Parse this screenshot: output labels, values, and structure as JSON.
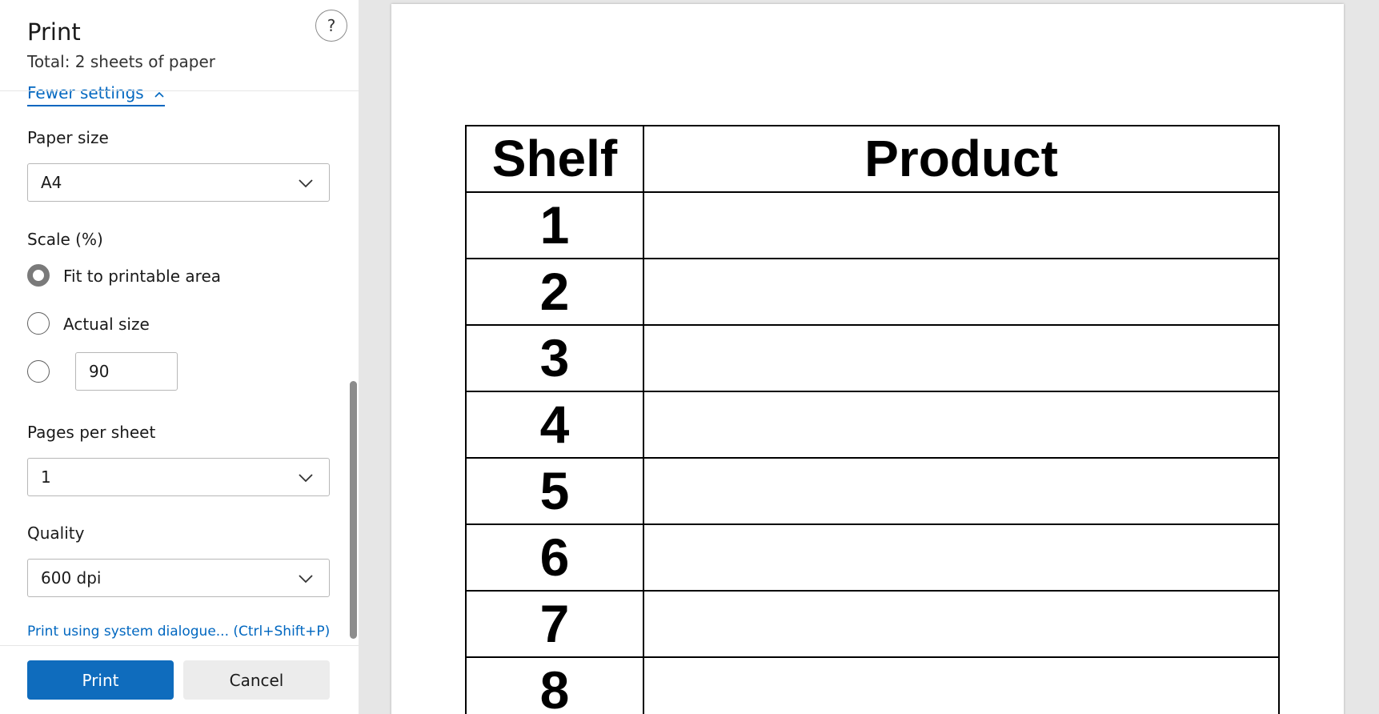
{
  "dialog": {
    "title": "Print",
    "subtitle": "Total: 2 sheets of paper",
    "help_label": "?",
    "fewer_settings_label": "Fewer settings",
    "paper_size": {
      "label": "Paper size",
      "value": "A4"
    },
    "scale": {
      "label": "Scale (%)",
      "options": [
        {
          "label": "Fit to printable area",
          "selected": true
        },
        {
          "label": "Actual size",
          "selected": false
        },
        {
          "label": "",
          "selected": false
        }
      ],
      "custom_value": "90"
    },
    "pages_per_sheet": {
      "label": "Pages per sheet",
      "value": "1"
    },
    "quality": {
      "label": "Quality",
      "value": "600 dpi"
    },
    "system_dialog_link": "Print using system dialogue... (Ctrl+Shift+P)",
    "print_label": "Print",
    "cancel_label": "Cancel"
  },
  "preview": {
    "table": {
      "headers": [
        "Shelf",
        "Product"
      ],
      "rows": [
        {
          "shelf": "1",
          "product": ""
        },
        {
          "shelf": "2",
          "product": ""
        },
        {
          "shelf": "3",
          "product": ""
        },
        {
          "shelf": "4",
          "product": ""
        },
        {
          "shelf": "5",
          "product": ""
        },
        {
          "shelf": "6",
          "product": ""
        },
        {
          "shelf": "7",
          "product": ""
        },
        {
          "shelf": "8",
          "product": ""
        }
      ]
    }
  },
  "colors": {
    "accent": "#0f6cbd",
    "link": "#0067c0",
    "preview_background": "#e6e6e6"
  },
  "icons": {
    "help": "question-mark-circle-icon",
    "fewer_settings": "chevron-up-icon",
    "dropdown": "chevron-down-icon"
  }
}
